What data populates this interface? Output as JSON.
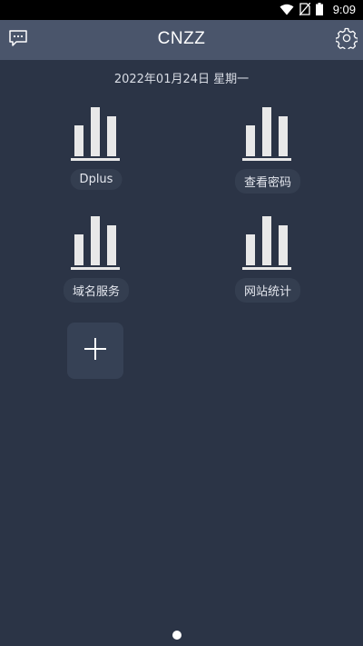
{
  "status_bar": {
    "time": "9:09",
    "icons": [
      "wifi-icon",
      "no-sim-icon",
      "battery-icon"
    ]
  },
  "app_bar": {
    "title": "CNZZ",
    "left_icon": "message-icon",
    "right_icon": "gear-icon"
  },
  "date_text": "2022年01月24日 星期一",
  "tiles": [
    {
      "label": "Dplus",
      "icon": "bar-chart-icon"
    },
    {
      "label": "查看密码",
      "icon": "bar-chart-icon"
    },
    {
      "label": "域名服务",
      "icon": "bar-chart-icon"
    },
    {
      "label": "网站统计",
      "icon": "bar-chart-icon"
    }
  ],
  "add_tile": {
    "icon": "plus-icon"
  },
  "pager": {
    "pages": 1,
    "current": 1
  },
  "colors": {
    "background": "#2b3446",
    "app_bar": "#4a556b",
    "label_pill": "#343e50",
    "icon": "#e8e8e8"
  }
}
